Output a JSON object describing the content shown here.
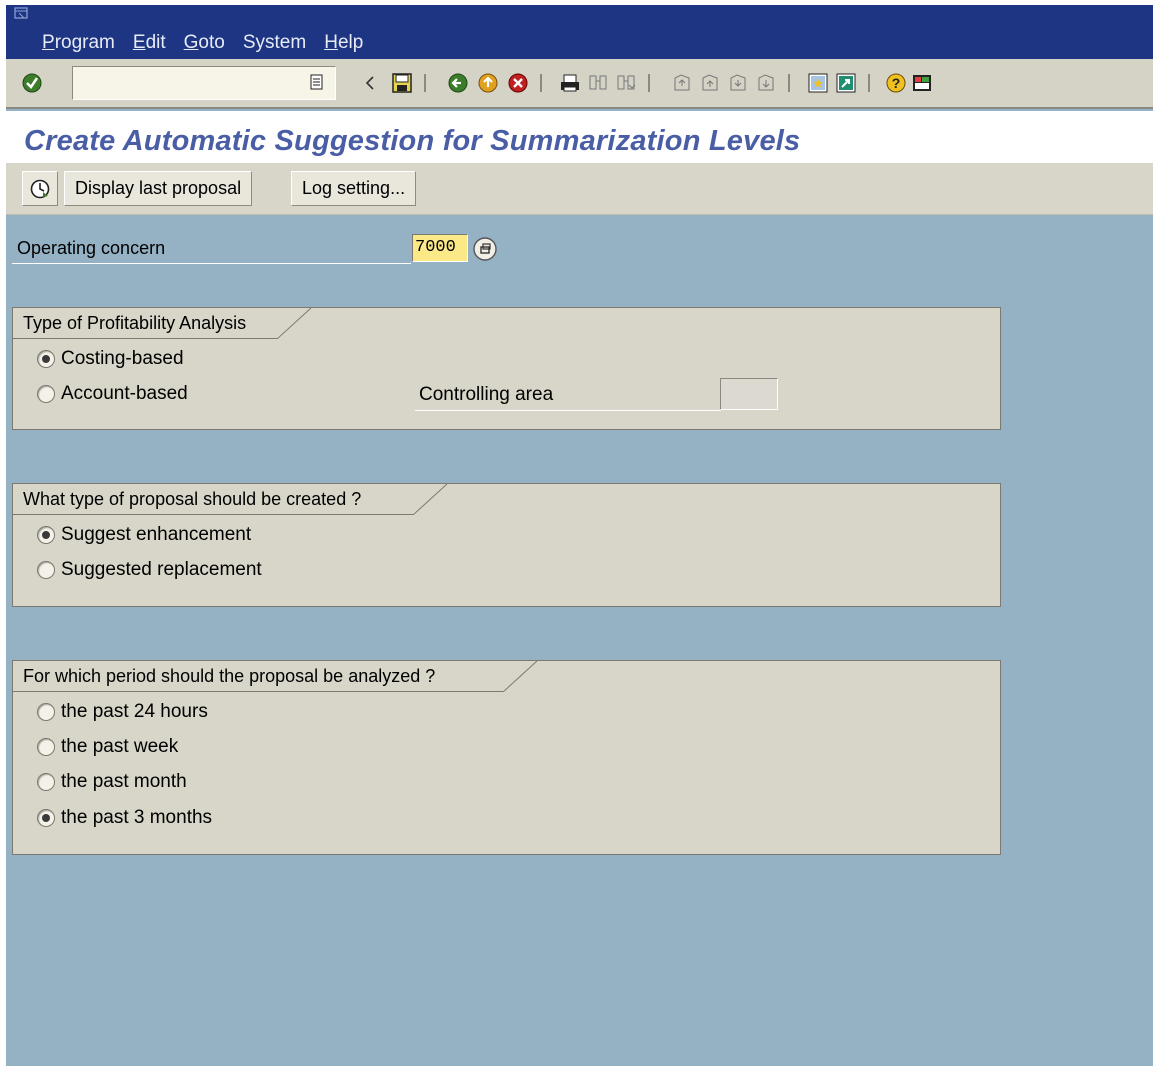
{
  "menu": {
    "items": [
      {
        "label": "Program",
        "accel": "P",
        "rest": "rogram"
      },
      {
        "label": "Edit",
        "accel": "E",
        "rest": "dit"
      },
      {
        "label": "Goto",
        "accel": "G",
        "rest": "oto"
      },
      {
        "label": "System",
        "accel": "",
        "rest": "System"
      },
      {
        "label": "Help",
        "accel": "H",
        "rest": "elp"
      }
    ]
  },
  "toolbar": {
    "command_value": "",
    "icons": [
      "enter-icon",
      "command-dropdown-icon",
      "back-arrow-icon",
      "save-icon",
      "back-icon",
      "exit-icon",
      "cancel-icon",
      "print-icon",
      "find-icon",
      "find-next-icon",
      "first-page-icon",
      "previous-page-icon",
      "next-page-icon",
      "last-page-icon",
      "create-session-icon",
      "shortcut-icon",
      "help-icon",
      "layout-menu-icon"
    ]
  },
  "page": {
    "title": "Create Automatic Suggestion for Summarization Levels"
  },
  "apptoolbar": {
    "execute_icon": "execute-icon",
    "display_last_proposal": "Display last proposal",
    "log_setting": "Log setting..."
  },
  "form": {
    "operating_concern_label": "Operating concern",
    "operating_concern_value": "7000",
    "controlling_area_label": "Controlling area",
    "controlling_area_value": ""
  },
  "groups": {
    "type": {
      "title": "Type of Profitability Analysis",
      "options": [
        {
          "label": "Costing-based",
          "selected": true
        },
        {
          "label": "Account-based",
          "selected": false
        }
      ]
    },
    "proposal": {
      "title": "What type of proposal should be created ?",
      "options": [
        {
          "label": "Suggest enhancement",
          "selected": true
        },
        {
          "label": "Suggested replacement",
          "selected": false
        }
      ]
    },
    "period": {
      "title": "For which period should the proposal be analyzed ?",
      "options": [
        {
          "label": "the past 24 hours",
          "selected": false
        },
        {
          "label": "the past week",
          "selected": false
        },
        {
          "label": "the past month",
          "selected": false
        },
        {
          "label": "the past 3 months",
          "selected": true
        }
      ]
    }
  },
  "colors": {
    "menubar": "#1d3583",
    "background": "#95b1c4",
    "title": "#4a5ea6",
    "panel": "#d8d6c8",
    "input_highlight": "#fbe987"
  }
}
